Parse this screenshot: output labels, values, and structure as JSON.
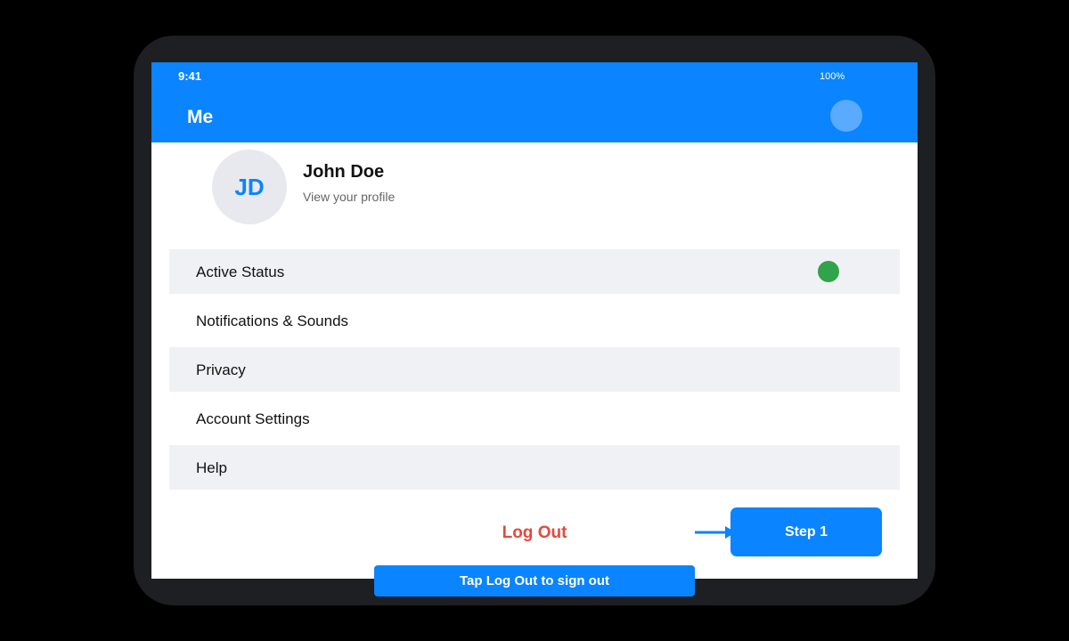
{
  "status_bar": {
    "time": "9:41",
    "battery": "100%"
  },
  "header": {
    "title": "Me"
  },
  "profile": {
    "initials": "JD",
    "name": "John Doe",
    "subtitle": "View your profile"
  },
  "menu": {
    "items": [
      {
        "label": "Active Status",
        "indicator_color": "#31a34a"
      },
      {
        "label": "Notifications & Sounds"
      },
      {
        "label": "Privacy"
      },
      {
        "label": "Account Settings"
      },
      {
        "label": "Help"
      }
    ]
  },
  "logout": {
    "label": "Log Out",
    "color": "#e5483b"
  },
  "tutorial": {
    "step_label": "Step 1",
    "hint": "Tap Log Out to sign out"
  },
  "colors": {
    "accent": "#0a84ff",
    "device_frame": "#1e1f22",
    "row_shade": "#f0f1f5"
  },
  "icons": {
    "header_avatar": "avatar-icon",
    "active_status_indicator": "status-dot-icon",
    "tutorial_pointer": "arrow-right-icon"
  }
}
